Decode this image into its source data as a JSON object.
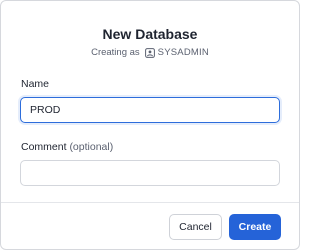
{
  "dialog": {
    "title": "New Database",
    "subtitle_prefix": "Creating as",
    "user_icon": "user-badge-icon",
    "user": "SYSADMIN"
  },
  "form": {
    "name": {
      "label": "Name",
      "value": "PROD"
    },
    "comment": {
      "label": "Comment",
      "optional_text": "(optional)",
      "value": ""
    }
  },
  "footer": {
    "cancel_label": "Cancel",
    "create_label": "Create"
  },
  "colors": {
    "accent": "#2563d8",
    "focus_border": "#2d6ddb",
    "text": "#1f2430",
    "muted_text": "#5b6170"
  }
}
